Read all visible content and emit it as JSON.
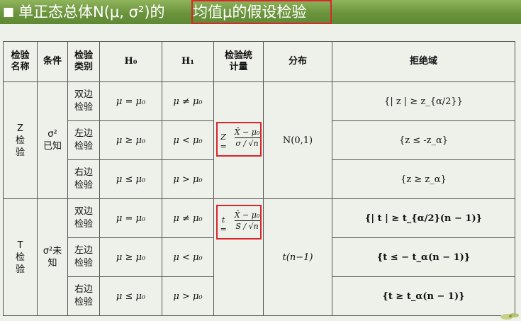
{
  "header": {
    "bullet": "■",
    "title_prefix": "单正态总体N(μ, σ²)的",
    "title_highlight": "均值μ的假设检验"
  },
  "table": {
    "headers": {
      "name": "检验\n名称",
      "condition": "条件",
      "type": "检验\n类别",
      "h0": "H₀",
      "h1": "H₁",
      "statistic": "检验统\n计量",
      "distribution": "分布",
      "rejection": "拒绝域"
    },
    "groups": [
      {
        "name": "Z\n检\n验",
        "condition": "σ²\n已知",
        "statistic_lhs": "Z =",
        "statistic_num": "X̄ − μ₀",
        "statistic_den": "σ / √n",
        "distribution": "N(0,1)",
        "rows": [
          {
            "type": "双边\n检验",
            "h0": "μ = μ₀",
            "h1": "μ ≠ μ₀",
            "rejection": "{| z | ≥ z_{α/2}}"
          },
          {
            "type": "左边\n检验",
            "h0": "μ ≥ μ₀",
            "h1": "μ < μ₀",
            "rejection": "{z ≤ -z_α}"
          },
          {
            "type": "右边\n检验",
            "h0": "μ ≤ μ₀",
            "h1": "μ > μ₀",
            "rejection": "{z ≥ z_α}"
          }
        ]
      },
      {
        "name": "T\n检\n验",
        "condition": "σ²未\n知",
        "statistic_lhs": "t =",
        "statistic_num": "X̄ − μ₀",
        "statistic_den": "S / √n",
        "distribution": "t(n−1)",
        "rows": [
          {
            "type": "双边\n检验",
            "h0": "μ = μ₀",
            "h1": "μ ≠ μ₀",
            "rejection": "{| t | ≥ t_{α/2}(n − 1)}"
          },
          {
            "type": "左边\n检验",
            "h0": "μ ≥ μ₀",
            "h1": "μ < μ₀",
            "rejection": "{t ≤ − t_α(n − 1)}"
          },
          {
            "type": "右边\n检验",
            "h0": "μ ≤ μ₀",
            "h1": "μ > μ₀",
            "rejection": "{t ≥ t_α(n − 1)}"
          }
        ]
      }
    ]
  },
  "colors": {
    "header_green": "#6b943c",
    "highlight_red": "#d8262c",
    "background": "#eef1ea"
  }
}
